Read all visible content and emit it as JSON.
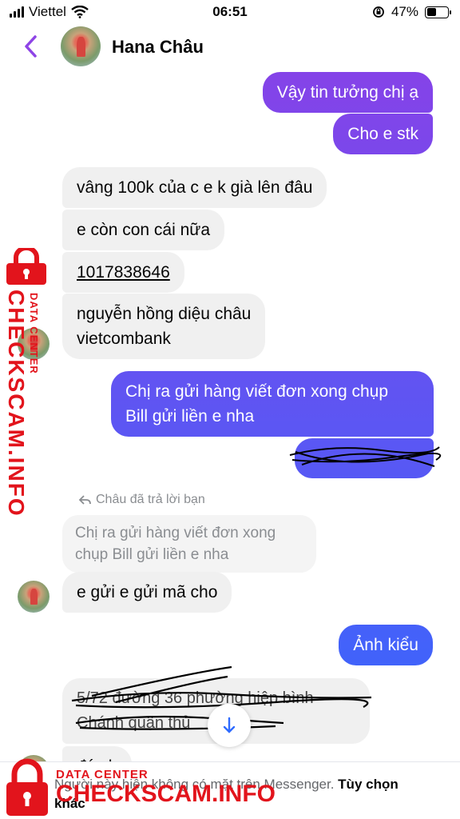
{
  "status_bar": {
    "carrier": "Viettel",
    "time": "06:51",
    "battery": "47%",
    "battery_level": 0.47
  },
  "header": {
    "contact_name": "Hana Châu"
  },
  "messages": [
    {
      "text": "Vậy tin tưởng chị ạ"
    },
    {
      "text": "Cho e stk"
    },
    {
      "text": "vâng 100k của c e k già lên đâu"
    },
    {
      "text": "e còn con cái nữa"
    },
    {
      "text": "1017838646"
    },
    {
      "text": "nguyễn hồng diệu châu\nvietcombank"
    },
    {
      "text": "Chị ra gửi hàng viết đơn xong chụp\nBill gửi liền e nha"
    },
    {
      "text": ""
    },
    {
      "text": "e gửi e gửi mã cho"
    },
    {
      "text": "Ảnh kiểu"
    },
    {
      "text": "5/72 đường 36 phường hiệp bình\nChánh quận thủ"
    },
    {
      "text": "đá ch"
    }
  ],
  "reply": {
    "label": "Châu đã trả lời bạn",
    "quoted_text": "Chị ra gửi hàng viết đơn xong\nchụp Bill gửi liền e nha"
  },
  "footer": {
    "notice": "Người này hiện không có mặt trên Messenger.",
    "notice_link": "Tùy chọn khác"
  },
  "watermark": {
    "title": "DATA CENTER",
    "brand": "CHECKSCAM.INFO"
  },
  "colors": {
    "out_top": "#8d3fe6",
    "out_bottom": "#2f6bff",
    "accent": "#8e44e6",
    "watermark": "#e2141c"
  }
}
